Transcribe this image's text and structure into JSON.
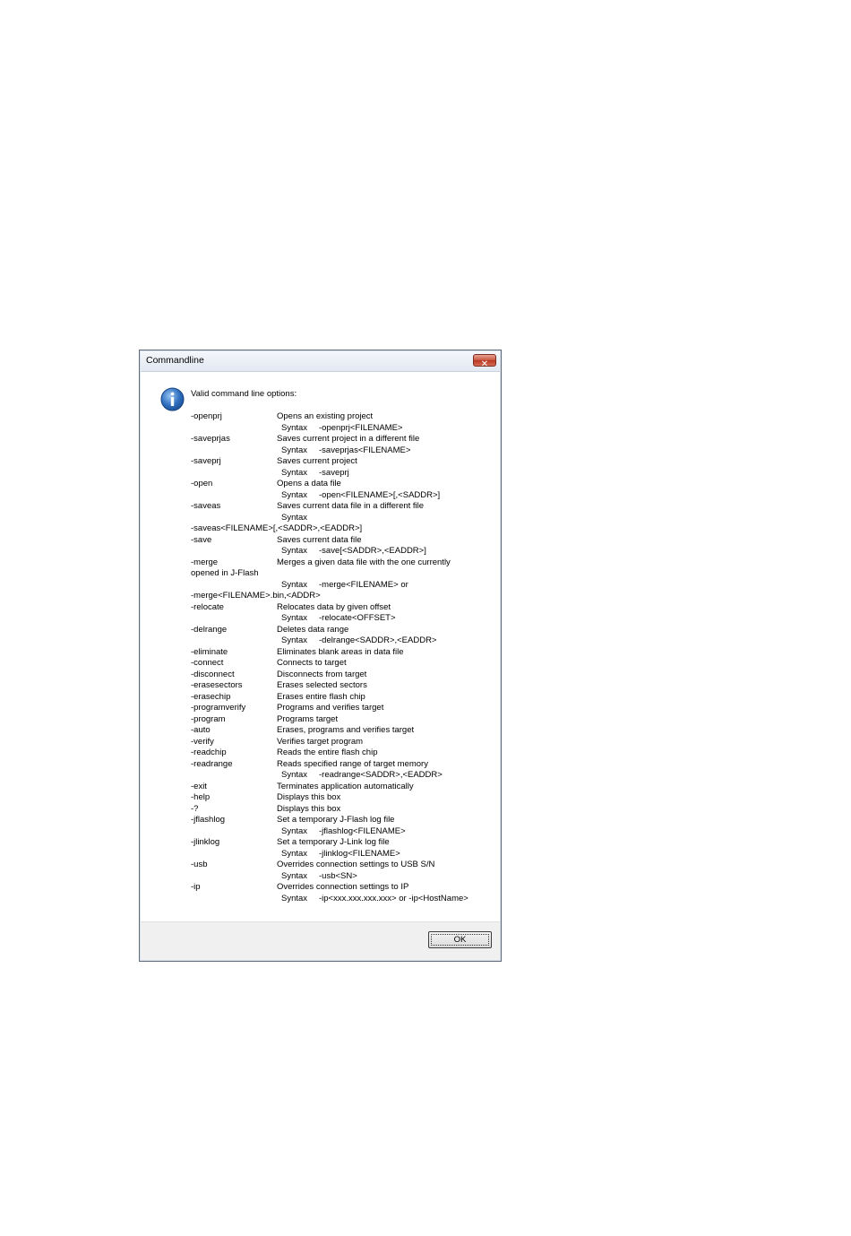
{
  "window": {
    "title": "Commandline",
    "close_label": "✕"
  },
  "heading": "Valid command line options:",
  "rows": [
    {
      "type": "opt",
      "name": "-openprj",
      "desc": "Opens an existing project"
    },
    {
      "type": "syntax",
      "label": "Syntax",
      "value": "-openprj<FILENAME>"
    },
    {
      "type": "opt",
      "name": "-saveprjas",
      "desc": "Saves current project in a different file"
    },
    {
      "type": "syntax",
      "label": "Syntax",
      "value": "-saveprjas<FILENAME>"
    },
    {
      "type": "opt",
      "name": "-saveprj",
      "desc": "Saves current project"
    },
    {
      "type": "syntax",
      "label": "Syntax",
      "value": "-saveprj"
    },
    {
      "type": "opt",
      "name": "-open",
      "desc": "Opens a data file"
    },
    {
      "type": "syntax",
      "label": "Syntax",
      "value": "-open<FILENAME>[,<SADDR>]"
    },
    {
      "type": "opt",
      "name": "-saveas",
      "desc": "Saves current data file in a different file"
    },
    {
      "type": "syntax",
      "label": "Syntax",
      "value": ""
    },
    {
      "type": "wrap",
      "text": "-saveas<FILENAME>[,<SADDR>,<EADDR>]"
    },
    {
      "type": "opt",
      "name": "-save",
      "desc": "Saves current data file"
    },
    {
      "type": "syntax",
      "label": "Syntax",
      "value": "-save[<SADDR>,<EADDR>]"
    },
    {
      "type": "opt",
      "name": "-merge",
      "desc": "Merges a given data file with the one currently"
    },
    {
      "type": "wrap",
      "text": "opened in J-Flash"
    },
    {
      "type": "syntax",
      "label": "Syntax",
      "value": "-merge<FILENAME> or"
    },
    {
      "type": "wrap",
      "text": "-merge<FILENAME>.bin,<ADDR>"
    },
    {
      "type": "opt",
      "name": "-relocate",
      "desc": "Relocates data by given offset"
    },
    {
      "type": "syntax",
      "label": "Syntax",
      "value": "-relocate<OFFSET>"
    },
    {
      "type": "opt",
      "name": "-delrange",
      "desc": "Deletes data range"
    },
    {
      "type": "syntax",
      "label": "Syntax",
      "value": "-delrange<SADDR>,<EADDR>"
    },
    {
      "type": "opt",
      "name": "-eliminate",
      "desc": "Eliminates blank areas in data file"
    },
    {
      "type": "opt",
      "name": "-connect",
      "desc": "Connects to target"
    },
    {
      "type": "opt",
      "name": "-disconnect",
      "desc": "Disconnects from target"
    },
    {
      "type": "opt",
      "name": "-erasesectors",
      "desc": "Erases selected sectors"
    },
    {
      "type": "opt",
      "name": "-erasechip",
      "desc": "Erases entire flash chip"
    },
    {
      "type": "opt",
      "name": "-programverify",
      "desc": "Programs and verifies target"
    },
    {
      "type": "opt",
      "name": "-program",
      "desc": "Programs target"
    },
    {
      "type": "opt",
      "name": "-auto",
      "desc": "Erases, programs and verifies target"
    },
    {
      "type": "opt",
      "name": "-verify",
      "desc": "Verifies target program"
    },
    {
      "type": "opt",
      "name": "-readchip",
      "desc": "Reads the entire flash chip"
    },
    {
      "type": "opt",
      "name": "-readrange",
      "desc": "Reads specified range of target memory"
    },
    {
      "type": "syntax",
      "label": "Syntax",
      "value": "-readrange<SADDR>,<EADDR>"
    },
    {
      "type": "opt",
      "name": "-exit",
      "desc": "Terminates application automatically"
    },
    {
      "type": "opt",
      "name": "-help",
      "desc": "Displays this box"
    },
    {
      "type": "opt",
      "name": "-?",
      "desc": "Displays this box"
    },
    {
      "type": "opt",
      "name": "-jflashlog",
      "desc": "Set a temporary J-Flash log file"
    },
    {
      "type": "syntax",
      "label": "Syntax",
      "value": "-jflashlog<FILENAME>"
    },
    {
      "type": "opt",
      "name": "-jlinklog",
      "desc": "Set a temporary J-Link log file"
    },
    {
      "type": "syntax",
      "label": "Syntax",
      "value": "-jlinklog<FILENAME>"
    },
    {
      "type": "opt",
      "name": "-usb",
      "desc": "Overrides connection settings to USB S/N"
    },
    {
      "type": "syntax",
      "label": "Syntax",
      "value": "-usb<SN>"
    },
    {
      "type": "opt",
      "name": "-ip",
      "desc": "Overrides connection settings to IP"
    },
    {
      "type": "syntax",
      "label": "Syntax",
      "value": "-ip<xxx.xxx.xxx.xxx> or -ip<HostName>"
    }
  ],
  "ok_label": "OK",
  "icon_name": "info-icon",
  "colors": {
    "info_blue": "#2f6fbf",
    "close_red": "#c8553f"
  }
}
